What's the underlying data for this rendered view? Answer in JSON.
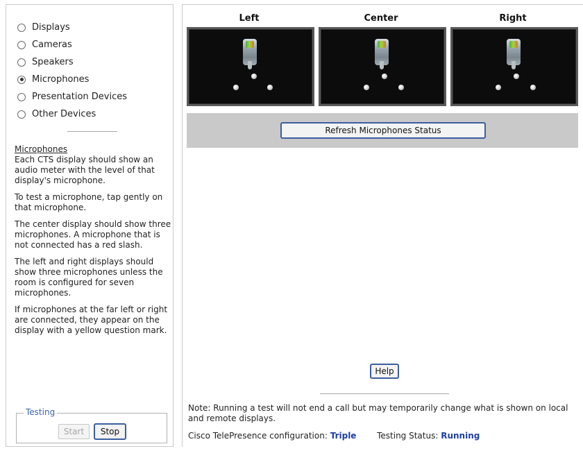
{
  "device_options": [
    {
      "label": "Displays",
      "selected": false
    },
    {
      "label": "Cameras",
      "selected": false
    },
    {
      "label": "Speakers",
      "selected": false
    },
    {
      "label": "Microphones",
      "selected": true
    },
    {
      "label": "Presentation Devices",
      "selected": false
    },
    {
      "label": "Other Devices",
      "selected": false
    }
  ],
  "help": {
    "title": "Microphones",
    "paragraphs": [
      "Each CTS display should show an audio meter with the level of that display's microphone.",
      "To test a microphone, tap gently on that microphone.",
      "The center display should show three microphones. A microphone that is not connected has a red slash.",
      "The left and right displays should show three microphones unless the room is configured for seven microphones.",
      "If microphones at the far left or right are connected, they appear on the display with a yellow question mark."
    ]
  },
  "testing": {
    "legend": "Testing",
    "start_label": "Start",
    "stop_label": "Stop"
  },
  "displays": {
    "left_label": "Left",
    "center_label": "Center",
    "right_label": "Right",
    "mic_icon": "microphone-level-meter-icon",
    "meter_colors": [
      "#3fb34a",
      "#a6d33a",
      "#d27a2c"
    ]
  },
  "refresh_label": "Refresh Microphones Status",
  "help_label": "Help",
  "note": "Note: Running a test will not end a call but may temporarily change what is shown on local and remote displays.",
  "status": {
    "config_label": "Cisco TelePresence configuration:",
    "config_value": "Triple",
    "testing_label": "Testing Status:",
    "testing_value": "Running"
  }
}
